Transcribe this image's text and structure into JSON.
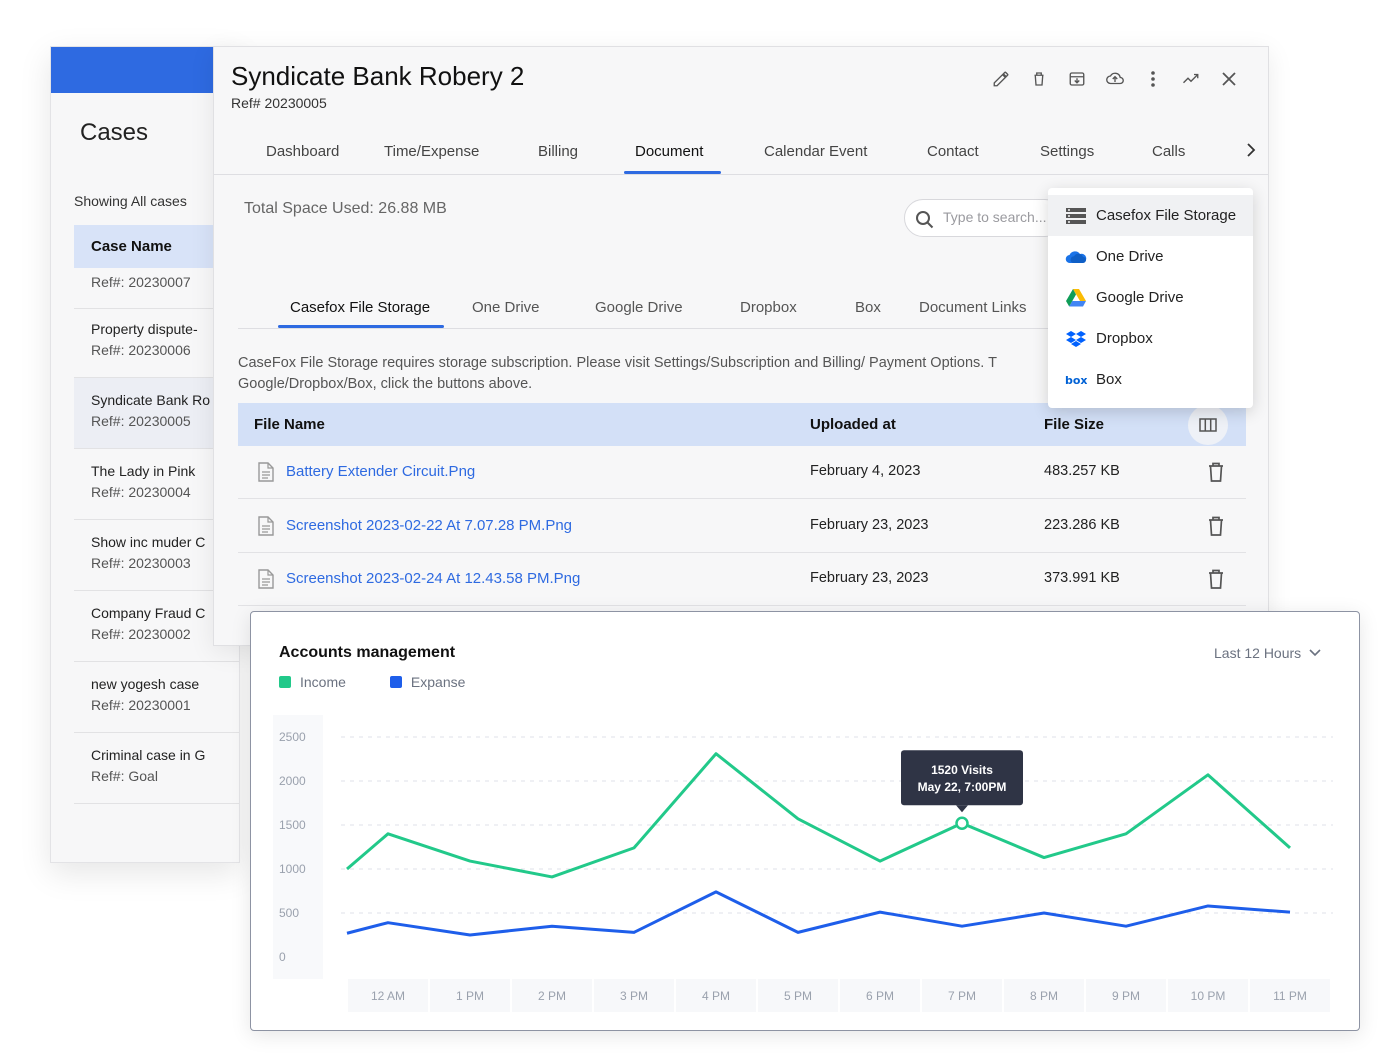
{
  "cases": {
    "title": "Cases",
    "showing": "Showing All cases",
    "column_header": "Case Name",
    "rows": [
      {
        "name": "",
        "ref": "Ref#: 20230007"
      },
      {
        "name": "Property dispute-",
        "ref": "Ref#: 20230006"
      },
      {
        "name": "Syndicate Bank Ro",
        "ref": "Ref#: 20230005"
      },
      {
        "name": "The Lady in Pink",
        "ref": "Ref#: 20230004"
      },
      {
        "name": "Show inc muder C",
        "ref": "Ref#: 20230003"
      },
      {
        "name": "Company Fraud C",
        "ref": "Ref#: 20230002"
      },
      {
        "name": "new yogesh case",
        "ref": "Ref#: 20230001"
      },
      {
        "name": "Criminal case in G",
        "ref": "Ref#: Goal"
      }
    ]
  },
  "case_detail": {
    "title": "Syndicate Bank Robery 2",
    "ref": "Ref# 20230005",
    "toolbar_icons": [
      "pencil-icon",
      "trash-icon",
      "archive-icon",
      "cloud-upload-icon",
      "more-vert-icon",
      "trending-icon",
      "close-icon"
    ],
    "tabs": [
      "Dashboard",
      "Time/Expense",
      "Billing",
      "Document",
      "Calendar Event",
      "Contact",
      "Settings",
      "Calls"
    ],
    "active_tab": "Document",
    "total_space": "Total Space Used: 26.88 MB",
    "search_placeholder": "Type to search...",
    "storage_tabs": [
      "Casefox File Storage",
      "One Drive",
      "Google Drive",
      "Dropbox",
      "Box",
      "Document Links"
    ],
    "notice_line1": "CaseFox File Storage requires storage subscription. Please visit Settings/Subscription and Billing/ Payment Options. T",
    "notice_line2": "Google/Dropbox/Box, click the buttons above.",
    "table": {
      "headers": [
        "File Name",
        "Uploaded at",
        "File Size"
      ],
      "rows": [
        {
          "name": "Battery Extender Circuit.Png",
          "date": "February 4, 2023",
          "size": "483.257 KB"
        },
        {
          "name": "Screenshot 2023-02-22 At 7.07.28 PM.Png",
          "date": "February 23, 2023",
          "size": "223.286 KB"
        },
        {
          "name": "Screenshot 2023-02-24 At 12.43.58 PM.Png",
          "date": "February 23, 2023",
          "size": "373.991 KB"
        }
      ]
    }
  },
  "storage_menu": {
    "items": [
      {
        "label": "Casefox File Storage",
        "icon": "server-icon"
      },
      {
        "label": "One Drive",
        "icon": "onedrive-icon"
      },
      {
        "label": "Google Drive",
        "icon": "google-drive-icon"
      },
      {
        "label": "Dropbox",
        "icon": "dropbox-icon"
      },
      {
        "label": "Box",
        "icon": "box-icon"
      }
    ]
  },
  "accounts_chart": {
    "title": "Accounts management",
    "range_label": "Last 12 Hours",
    "tooltip_value": "1520 Visits",
    "tooltip_time": "May 22, 7:00PM"
  },
  "chart_data": {
    "type": "line",
    "title": "Accounts management",
    "xlabel": "",
    "ylabel": "",
    "x": [
      "12 AM",
      "1 PM",
      "2 PM",
      "3 PM",
      "4 PM",
      "5 PM",
      "6 PM",
      "7 PM",
      "8 PM",
      "9 PM",
      "10 PM",
      "11 PM"
    ],
    "y_ticks": [
      2500,
      2000,
      1500,
      1000,
      500,
      0
    ],
    "ylim": [
      0,
      2500
    ],
    "series": [
      {
        "name": "Income",
        "color": "#22c98a",
        "x": [
          0,
          0.5,
          1.5,
          2.5,
          3.5,
          4.5,
          5.5,
          6.5,
          7.5,
          8.5,
          9.5,
          10.5,
          11.5
        ],
        "values": [
          1000,
          1400,
          1090,
          910,
          1240,
          2310,
          1570,
          1090,
          1520,
          1130,
          1400,
          2070,
          1240
        ]
      },
      {
        "name": "Expanse",
        "color": "#1e5eea",
        "x": [
          0,
          0.5,
          1.5,
          2.5,
          3.5,
          4.5,
          5.5,
          6.5,
          7.5,
          8.5,
          9.5,
          10.5,
          11.5
        ],
        "values": [
          270,
          390,
          250,
          350,
          280,
          740,
          280,
          510,
          350,
          500,
          350,
          580,
          510
        ]
      }
    ],
    "highlight": {
      "series": "Income",
      "x": "7 PM",
      "value": 1520
    },
    "grid": true,
    "legend": "top-left"
  }
}
